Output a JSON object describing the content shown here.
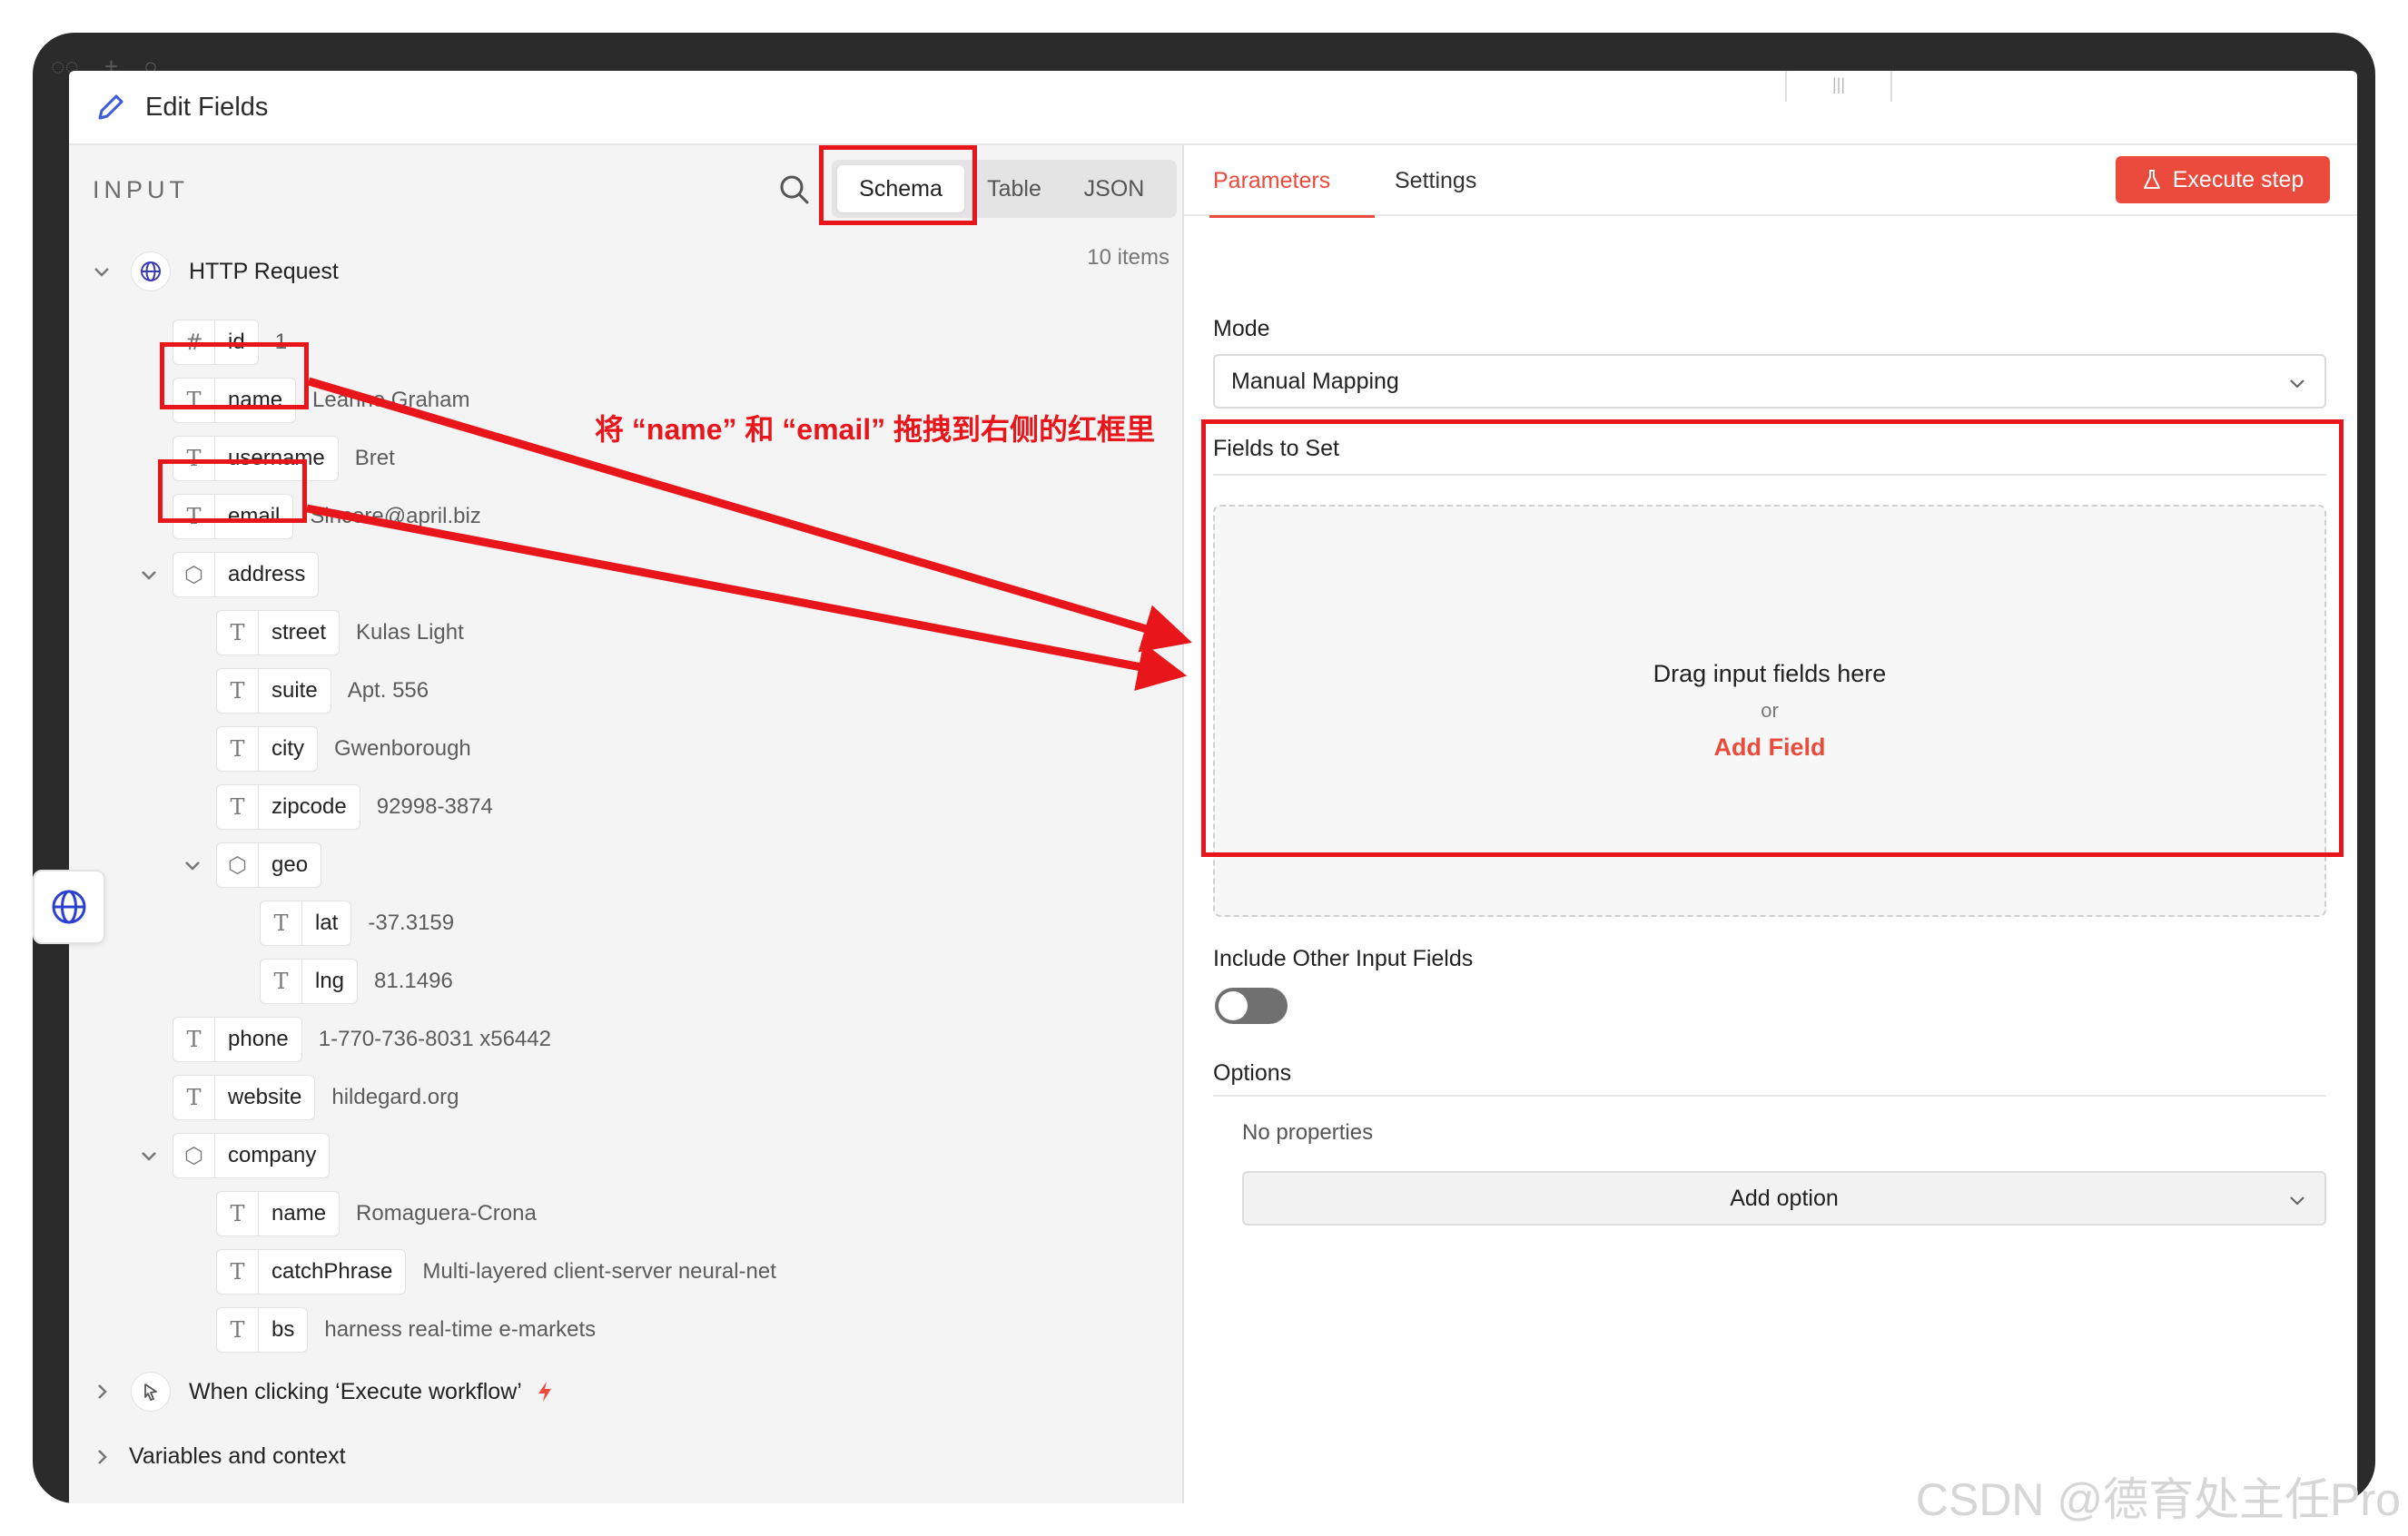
{
  "window": {
    "title": "Edit Fields"
  },
  "input_panel": {
    "label": "INPUT",
    "view_tabs": [
      "Schema",
      "Table",
      "JSON"
    ],
    "active_view": "Schema",
    "source": {
      "name": "HTTP Request",
      "count": "10 items"
    },
    "fields": {
      "id": {
        "key": "id",
        "value": "1"
      },
      "name": {
        "key": "name",
        "value": "Leanne Graham"
      },
      "username": {
        "key": "username",
        "value": "Bret"
      },
      "email": {
        "key": "email",
        "value": "Sincere@april.biz"
      },
      "address": {
        "key": "address"
      },
      "street": {
        "key": "street",
        "value": "Kulas Light"
      },
      "suite": {
        "key": "suite",
        "value": "Apt. 556"
      },
      "city": {
        "key": "city",
        "value": "Gwenborough"
      },
      "zipcode": {
        "key": "zipcode",
        "value": "92998-3874"
      },
      "geo": {
        "key": "geo"
      },
      "lat": {
        "key": "lat",
        "value": "-37.3159"
      },
      "lng": {
        "key": "lng",
        "value": "81.1496"
      },
      "phone": {
        "key": "phone",
        "value": "1-770-736-8031 x56442"
      },
      "website": {
        "key": "website",
        "value": "hildegard.org"
      },
      "company": {
        "key": "company"
      },
      "company_name": {
        "key": "name",
        "value": "Romaguera-Crona"
      },
      "catchPhrase": {
        "key": "catchPhrase",
        "value": "Multi-layered client-server neural-net"
      },
      "bs": {
        "key": "bs",
        "value": "harness real-time e-markets"
      }
    },
    "trigger_node": "When clicking ‘Execute workflow’",
    "variables": "Variables and context"
  },
  "params_panel": {
    "tabs": [
      "Parameters",
      "Settings"
    ],
    "active_tab": "Parameters",
    "execute_label": "Execute step",
    "mode_label": "Mode",
    "mode_value": "Manual Mapping",
    "fields_to_set_label": "Fields to Set",
    "dropzone": {
      "text": "Drag input fields here",
      "or": "or",
      "add_field": "Add Field"
    },
    "include_other_label": "Include Other Input Fields",
    "include_other_enabled": false,
    "options_label": "Options",
    "no_properties": "No properties",
    "add_option": "Add option"
  },
  "annotation": {
    "text": "将 “name” 和 “email” 拖拽到右侧的红框里",
    "color": "#e8161b"
  },
  "watermark": "CSDN @德育处主任Pro",
  "colors": {
    "accent": "#ea4b3c",
    "annotation": "#e8161b",
    "panel_bg": "#f4f4f4"
  }
}
